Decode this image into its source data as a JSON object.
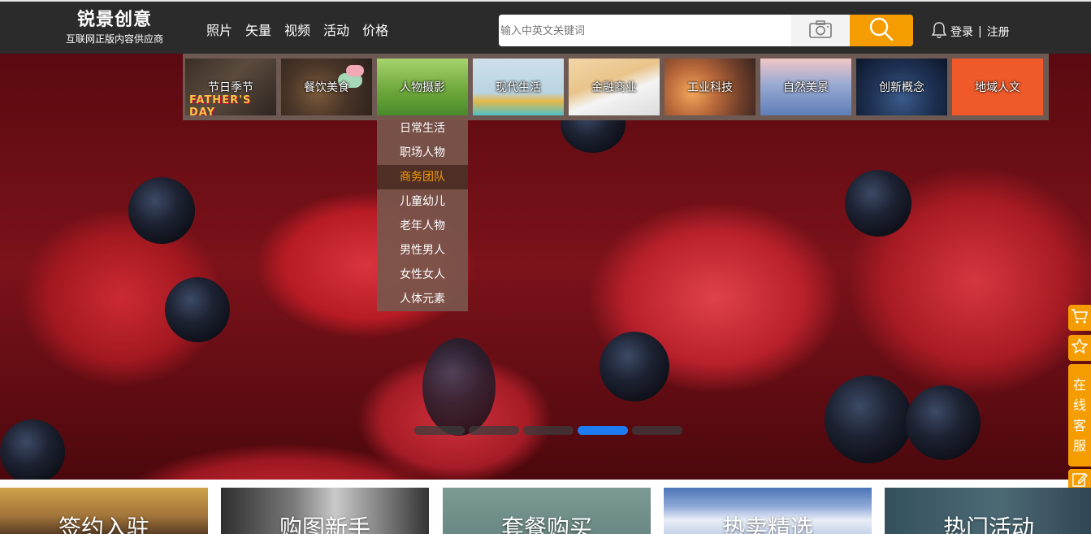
{
  "header": {
    "logo_title": "锐景创意",
    "logo_subtitle": "互联网正版内容供应商",
    "nav": [
      "照片",
      "矢量",
      "视频",
      "活动",
      "价格"
    ],
    "search_placeholder": "输入中英文关键词",
    "login": "登录",
    "separator": "|",
    "register": "注册"
  },
  "categories": [
    "节日季节",
    "餐饮美食",
    "人物摄影",
    "现代生活",
    "金融商业",
    "工业科技",
    "自然美景",
    "创新概念",
    "地域人文"
  ],
  "dropdown": {
    "items": [
      "日常生活",
      "职场人物",
      "商务团队",
      "儿童幼儿",
      "老年人物",
      "男性男人",
      "女性女人",
      "人体元素"
    ],
    "active_index": 2
  },
  "slider": {
    "count": 5,
    "active_index": 3
  },
  "float_bar": {
    "service_chars": [
      "在",
      "线",
      "客",
      "服"
    ],
    "icons": [
      "cart-icon",
      "star-icon",
      "edit-icon"
    ]
  },
  "cards": [
    "签约入驻",
    "购图新手",
    "套餐购买",
    "热卖精选",
    "热门活动"
  ],
  "colors": {
    "accent": "#f59d00",
    "header_bg": "#2b2b2b",
    "active_dot": "#1e7cf2"
  }
}
